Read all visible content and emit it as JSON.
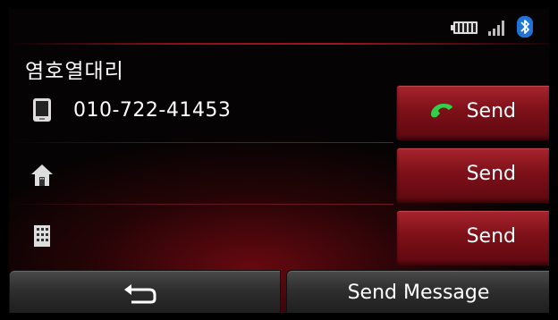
{
  "status": {
    "battery_icon": "battery-icon",
    "signal_icon": "signal-bars-icon",
    "bluetooth_icon": "bluetooth-icon"
  },
  "contact": {
    "name": "염호열대리"
  },
  "rows": [
    {
      "icon": "mobile-phone-icon",
      "number": "010-722-41453",
      "send_label": "Send",
      "send_icon": "call-icon"
    },
    {
      "icon": "home-icon",
      "number": "",
      "send_label": "Send"
    },
    {
      "icon": "office-building-icon",
      "number": "",
      "send_label": "Send"
    }
  ],
  "bottom": {
    "back_icon": "back-arrow-icon",
    "send_message_label": "Send Message"
  },
  "colors": {
    "accent_red": "#8a1018",
    "call_green": "#2fd04a",
    "bluetooth_blue": "#1f74d6"
  }
}
